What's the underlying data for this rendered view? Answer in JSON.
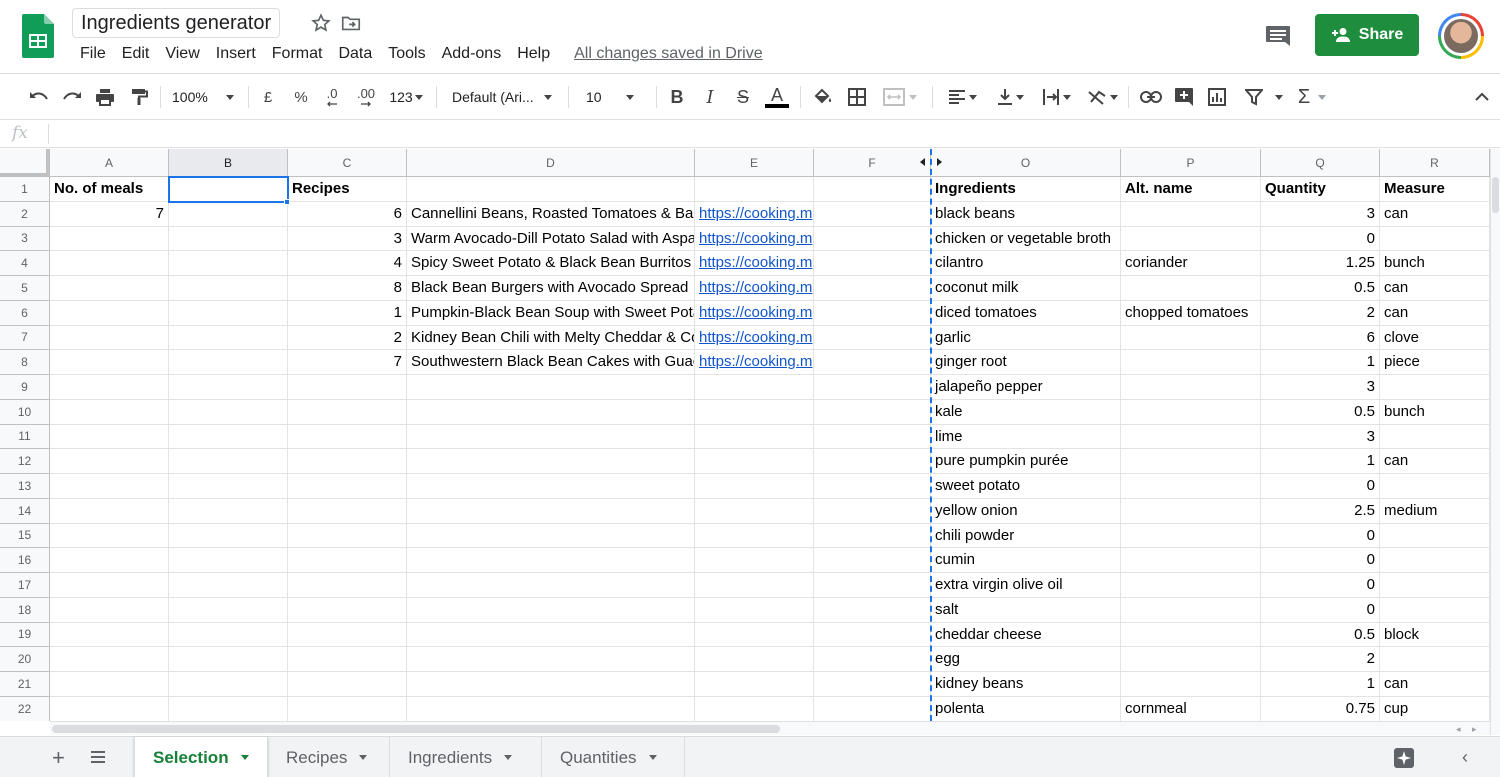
{
  "header": {
    "title": "Ingredients generator",
    "menu": [
      "File",
      "Edit",
      "View",
      "Insert",
      "Format",
      "Data",
      "Tools",
      "Add-ons",
      "Help"
    ],
    "saved_status": "All changes saved in Drive",
    "share_label": "Share"
  },
  "toolbar": {
    "zoom": "100%",
    "currency": "£",
    "percent": "%",
    "dec_less": ".0",
    "dec_more": ".00",
    "more_formats": "123",
    "font": "Default (Ari...",
    "font_size": "10",
    "bold": "B",
    "italic": "I",
    "strike": "S",
    "text_color": "A",
    "functions": "Σ",
    "accent_color": "#1a73e8"
  },
  "formula_bar": {
    "fx": "fx",
    "value": ""
  },
  "grid": {
    "left_columns": [
      "A",
      "B",
      "C",
      "D",
      "E",
      "F"
    ],
    "right_columns": [
      "O",
      "P",
      "Q",
      "R"
    ],
    "selected_column": "B",
    "rows": [
      "1",
      "2",
      "3",
      "4",
      "5",
      "6",
      "7",
      "8",
      "9",
      "10",
      "11",
      "12",
      "13",
      "14",
      "15",
      "16",
      "17",
      "18",
      "19",
      "20",
      "21",
      "22"
    ],
    "selection_headers": {
      "meals": "No. of meals",
      "recipes": "Recipes"
    },
    "meals_value": "7",
    "recipes": [
      {
        "qty": "6",
        "name": "Cannellini Beans, Roasted Tomatoes & Basil",
        "url": "https://cooking.m"
      },
      {
        "qty": "3",
        "name": "Warm Avocado-Dill Potato Salad with Asparagus",
        "url": "https://cooking.m"
      },
      {
        "qty": "4",
        "name": "Spicy Sweet Potato & Black Bean Burritos",
        "url": "https://cooking.m"
      },
      {
        "qty": "8",
        "name": "Black Bean Burgers with Avocado Spread",
        "url": "https://cooking.m"
      },
      {
        "qty": "1",
        "name": "Pumpkin-Black Bean Soup with Sweet Potato",
        "url": "https://cooking.m"
      },
      {
        "qty": "2",
        "name": "Kidney Bean Chili with Melty Cheddar & Corn",
        "url": "https://cooking.m"
      },
      {
        "qty": "7",
        "name": "Southwestern Black Bean Cakes with Guacamole",
        "url": "https://cooking.m"
      }
    ],
    "ingredient_headers": {
      "ingredients": "Ingredients",
      "alt": "Alt. name",
      "quantity": "Quantity",
      "measure": "Measure"
    },
    "ingredients": [
      {
        "name": "black beans",
        "alt": "",
        "qty": "3",
        "measure": "can"
      },
      {
        "name": "chicken or vegetable broth",
        "alt": "",
        "qty": "0",
        "measure": ""
      },
      {
        "name": "cilantro",
        "alt": "coriander",
        "qty": "1.25",
        "measure": "bunch"
      },
      {
        "name": "coconut milk",
        "alt": "",
        "qty": "0.5",
        "measure": "can"
      },
      {
        "name": "diced tomatoes",
        "alt": "chopped tomatoes",
        "qty": "2",
        "measure": "can"
      },
      {
        "name": "garlic",
        "alt": "",
        "qty": "6",
        "measure": "clove"
      },
      {
        "name": "ginger root",
        "alt": "",
        "qty": "1",
        "measure": "piece"
      },
      {
        "name": "jalapeño pepper",
        "alt": "",
        "qty": "3",
        "measure": ""
      },
      {
        "name": "kale",
        "alt": "",
        "qty": "0.5",
        "measure": "bunch"
      },
      {
        "name": "lime",
        "alt": "",
        "qty": "3",
        "measure": ""
      },
      {
        "name": "pure pumpkin purée",
        "alt": "",
        "qty": "1",
        "measure": "can"
      },
      {
        "name": "sweet potato",
        "alt": "",
        "qty": "0",
        "measure": ""
      },
      {
        "name": "yellow onion",
        "alt": "",
        "qty": "2.5",
        "measure": "medium"
      },
      {
        "name": "chili powder",
        "alt": "",
        "qty": "0",
        "measure": ""
      },
      {
        "name": "cumin",
        "alt": "",
        "qty": "0",
        "measure": ""
      },
      {
        "name": "extra virgin olive oil",
        "alt": "",
        "qty": "0",
        "measure": ""
      },
      {
        "name": "salt",
        "alt": "",
        "qty": "0",
        "measure": ""
      },
      {
        "name": "cheddar cheese",
        "alt": "",
        "qty": "0.5",
        "measure": "block"
      },
      {
        "name": "egg",
        "alt": "",
        "qty": "2",
        "measure": ""
      },
      {
        "name": "kidney beans",
        "alt": "",
        "qty": "1",
        "measure": "can"
      },
      {
        "name": "polenta",
        "alt": "cornmeal",
        "qty": "0.75",
        "measure": "cup"
      }
    ]
  },
  "sheets": [
    {
      "label": "Selection",
      "active": true
    },
    {
      "label": "Recipes",
      "active": false
    },
    {
      "label": "Ingredients",
      "active": false
    },
    {
      "label": "Quantities",
      "active": false
    }
  ],
  "colors": {
    "brand_green": "#1e8e3e",
    "active_tab_green": "#188038",
    "link_blue": "#1155cc"
  }
}
